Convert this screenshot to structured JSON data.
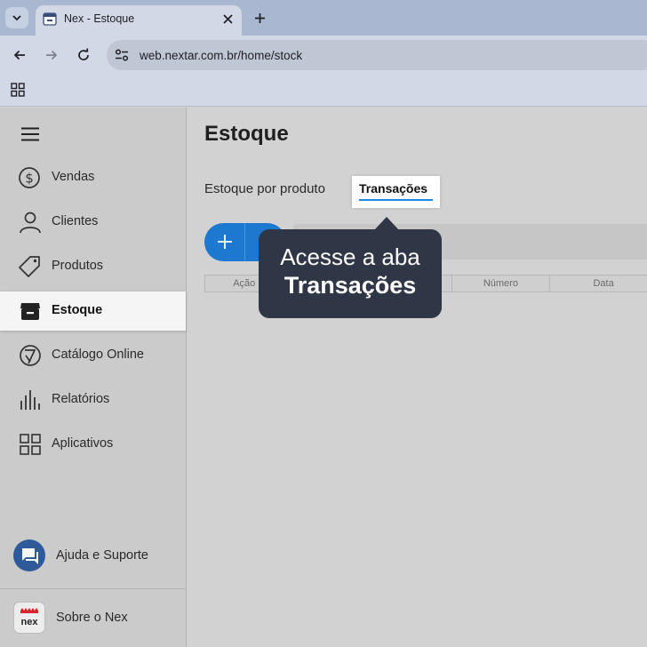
{
  "browser": {
    "tab_title": "Nex - Estoque",
    "url": "web.nextar.com.br/home/stock"
  },
  "sidebar": {
    "items": [
      {
        "label": "Vendas",
        "icon": "dollar-circle-icon"
      },
      {
        "label": "Clientes",
        "icon": "person-icon"
      },
      {
        "label": "Produtos",
        "icon": "tag-icon"
      },
      {
        "label": "Estoque",
        "icon": "box-icon",
        "active": true
      },
      {
        "label": "Catálogo Online",
        "icon": "catalog-icon"
      },
      {
        "label": "Relatórios",
        "icon": "bar-chart-icon"
      },
      {
        "label": "Aplicativos",
        "icon": "grid-icon"
      }
    ],
    "support_label": "Ajuda e Suporte",
    "about_label": "Sobre o Nex",
    "about_logo_text": "nex"
  },
  "main": {
    "title": "Estoque",
    "subtabs": [
      "Estoque por produto",
      "Transações"
    ],
    "active_subtab": "Transações",
    "table_headers": [
      "Ação",
      "",
      "",
      "Número",
      "Data"
    ]
  },
  "tooltip": {
    "line1": "Acesse a aba",
    "line2": "Transações"
  },
  "colors": {
    "accent": "#1d78cf",
    "tooltip_bg": "#2f3746",
    "support_avatar": "#2e5a9a"
  }
}
